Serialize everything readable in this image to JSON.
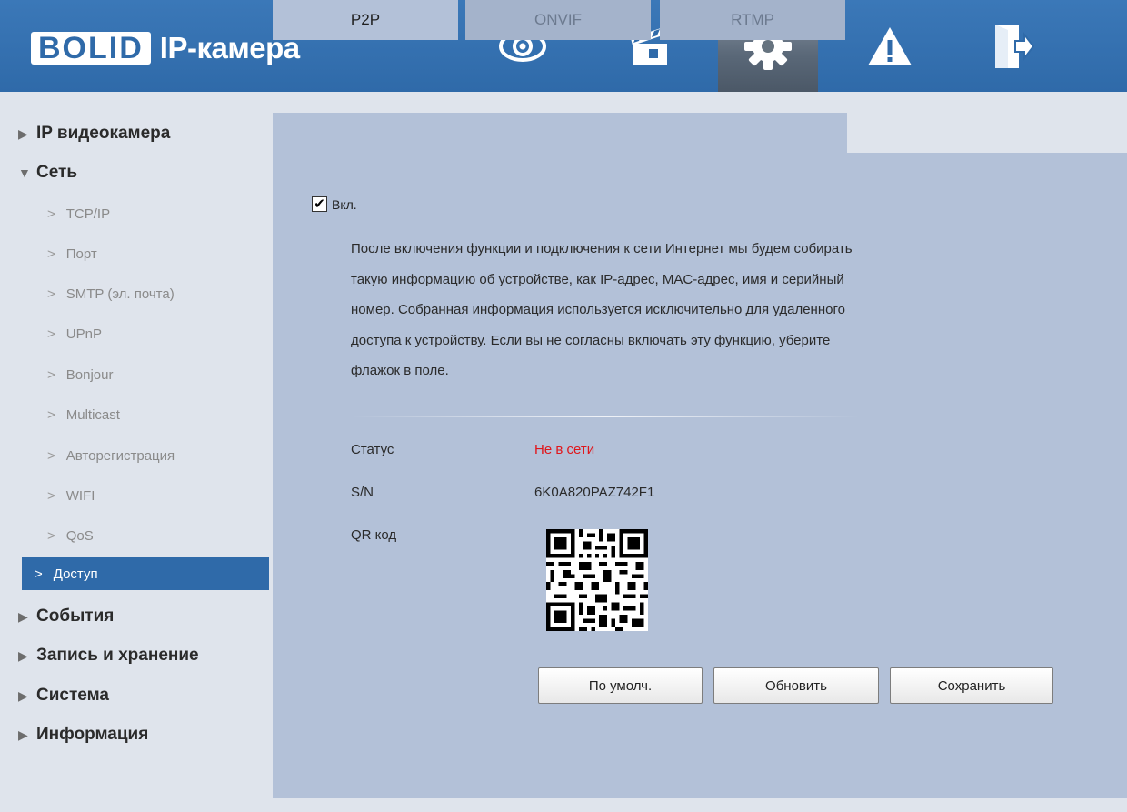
{
  "header": {
    "logo_brand": "BOLID",
    "logo_product": "IP-камера",
    "nav": [
      {
        "icon": "eye-icon",
        "name": "live-view"
      },
      {
        "icon": "clapperboard-icon",
        "name": "playback"
      },
      {
        "icon": "gear-icon",
        "name": "settings",
        "active": true
      },
      {
        "icon": "warning-icon",
        "name": "alarm"
      },
      {
        "icon": "logout-icon",
        "name": "logout"
      }
    ]
  },
  "sidebar": {
    "sections": [
      {
        "label": "IP видеокамера",
        "expanded": false
      },
      {
        "label": "Сеть",
        "expanded": true
      },
      {
        "label": "События",
        "expanded": false
      },
      {
        "label": "Запись и хранение",
        "expanded": false
      },
      {
        "label": "Система",
        "expanded": false
      },
      {
        "label": "Информация",
        "expanded": false
      }
    ],
    "network_items": [
      "TCP/IP",
      "Порт",
      "SMTP (эл. почта)",
      "UPnP",
      "Bonjour",
      "Multicast",
      "Авторегистрация",
      "WIFI",
      "QoS",
      "Доступ"
    ],
    "active_item": "Доступ"
  },
  "tabs": [
    {
      "label": "P2P",
      "active": true
    },
    {
      "label": "ONVIF",
      "active": false
    },
    {
      "label": "RTMP",
      "active": false
    }
  ],
  "p2p": {
    "enable_label": "Вкл.",
    "enabled": true,
    "description_lines": [
      "После включения функции и подключения к сети Интернет мы будем собирать",
      "такую информацию об устройстве, как IP-адрес, MAC-адрес, имя и серийный",
      "номер. Собранная информация используется исключительно для удаленного",
      "доступа к устройству. Если вы не согласны включать эту функцию, уберите",
      "флажок в поле."
    ],
    "status_label": "Статус",
    "status_value": "Не в сети",
    "sn_label": "S/N",
    "sn_value": "6K0A820PAZ742F1",
    "qr_label": "QR код"
  },
  "buttons": {
    "default": "По умолч.",
    "refresh": "Обновить",
    "save": "Сохранить"
  },
  "colors": {
    "accent": "#2f6aa9",
    "status_offline": "#e0161b",
    "panel": "#b3c1d8"
  }
}
